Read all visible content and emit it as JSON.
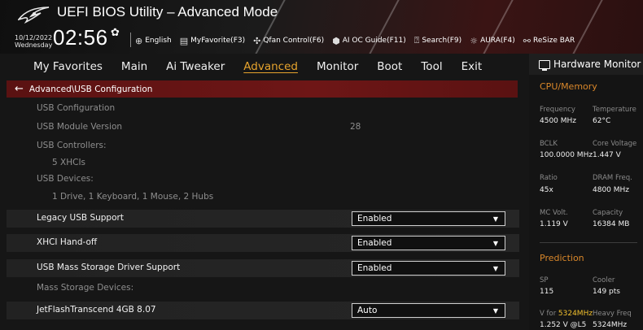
{
  "header": {
    "title": "UEFI BIOS Utility – Advanced Mode",
    "date": "10/12/2022",
    "day": "Wednesday",
    "time": "02:56",
    "toolbar": [
      {
        "name": "language",
        "icon": "globe-icon",
        "label": "English"
      },
      {
        "name": "myfavorite",
        "icon": "favorite-icon",
        "label": "MyFavorite(F3)"
      },
      {
        "name": "qfan",
        "icon": "fan-icon",
        "label": "Qfan Control(F6)"
      },
      {
        "name": "ai-oc-guide",
        "icon": "ai-oc-icon",
        "label": "AI OC Guide(F11)"
      },
      {
        "name": "search",
        "icon": "search-icon",
        "label": "Search(F9)"
      },
      {
        "name": "aura",
        "icon": "aura-icon",
        "label": "AURA(F4)"
      },
      {
        "name": "resize-bar",
        "icon": "resize-bar-icon",
        "label": "ReSize BAR"
      }
    ]
  },
  "nav": {
    "tabs": [
      "My Favorites",
      "Main",
      "Ai Tweaker",
      "Advanced",
      "Monitor",
      "Boot",
      "Tool",
      "Exit"
    ],
    "active": "Advanced"
  },
  "breadcrumb": "Advanced\\USB Configuration",
  "settings": {
    "usb_config_label": "USB Configuration",
    "usb_module_label": "USB Module Version",
    "usb_module_value": "28",
    "usb_controllers_label": "USB Controllers:",
    "usb_controllers_value": "5 XHCIs",
    "usb_devices_label": "USB Devices:",
    "usb_devices_value": "1 Drive, 1 Keyboard, 1 Mouse, 2 Hubs",
    "legacy_label": "Legacy USB Support",
    "legacy_value": "Enabled",
    "xhci_label": "XHCI Hand-off",
    "xhci_value": "Enabled",
    "mass_storage_label": "USB Mass Storage Driver Support",
    "mass_storage_value": "Enabled",
    "mass_devices_label": "Mass Storage Devices:",
    "jetflash_label": "JetFlashTranscend 4GB 8.07",
    "jetflash_value": "Auto"
  },
  "hw_monitor": {
    "title": "Hardware Monitor",
    "cpu_section": "CPU/Memory",
    "frequency_label": "Frequency",
    "frequency_value": "4500 MHz",
    "temperature_label": "Temperature",
    "temperature_value": "62°C",
    "bclk_label": "BCLK",
    "bclk_value": "100.0000 MHz",
    "core_voltage_label": "Core Voltage",
    "core_voltage_value": "1.447 V",
    "ratio_label": "Ratio",
    "ratio_value": "45x",
    "dram_label": "DRAM Freq.",
    "dram_value": "4800 MHz",
    "mc_volt_label": "MC Volt.",
    "mc_volt_value": "1.119 V",
    "capacity_label": "Capacity",
    "capacity_value": "16384 MB",
    "prediction_section": "Prediction",
    "sp_label": "SP",
    "sp_value": "115",
    "cooler_label": "Cooler",
    "cooler_value": "149 pts",
    "v_for_prefix": "V for ",
    "v_for_freq": "5324MHz",
    "heavy_freq_label": "Heavy Freq",
    "v_for_value": "1.252 V @L5",
    "heavy_freq_value": "5324MHz"
  },
  "colors": {
    "accent_orange": "#e6a32d",
    "section_orange": "#d9872a",
    "highlight_yellow": "#f2c12e",
    "breadcrumb_red": "#6e1616"
  }
}
